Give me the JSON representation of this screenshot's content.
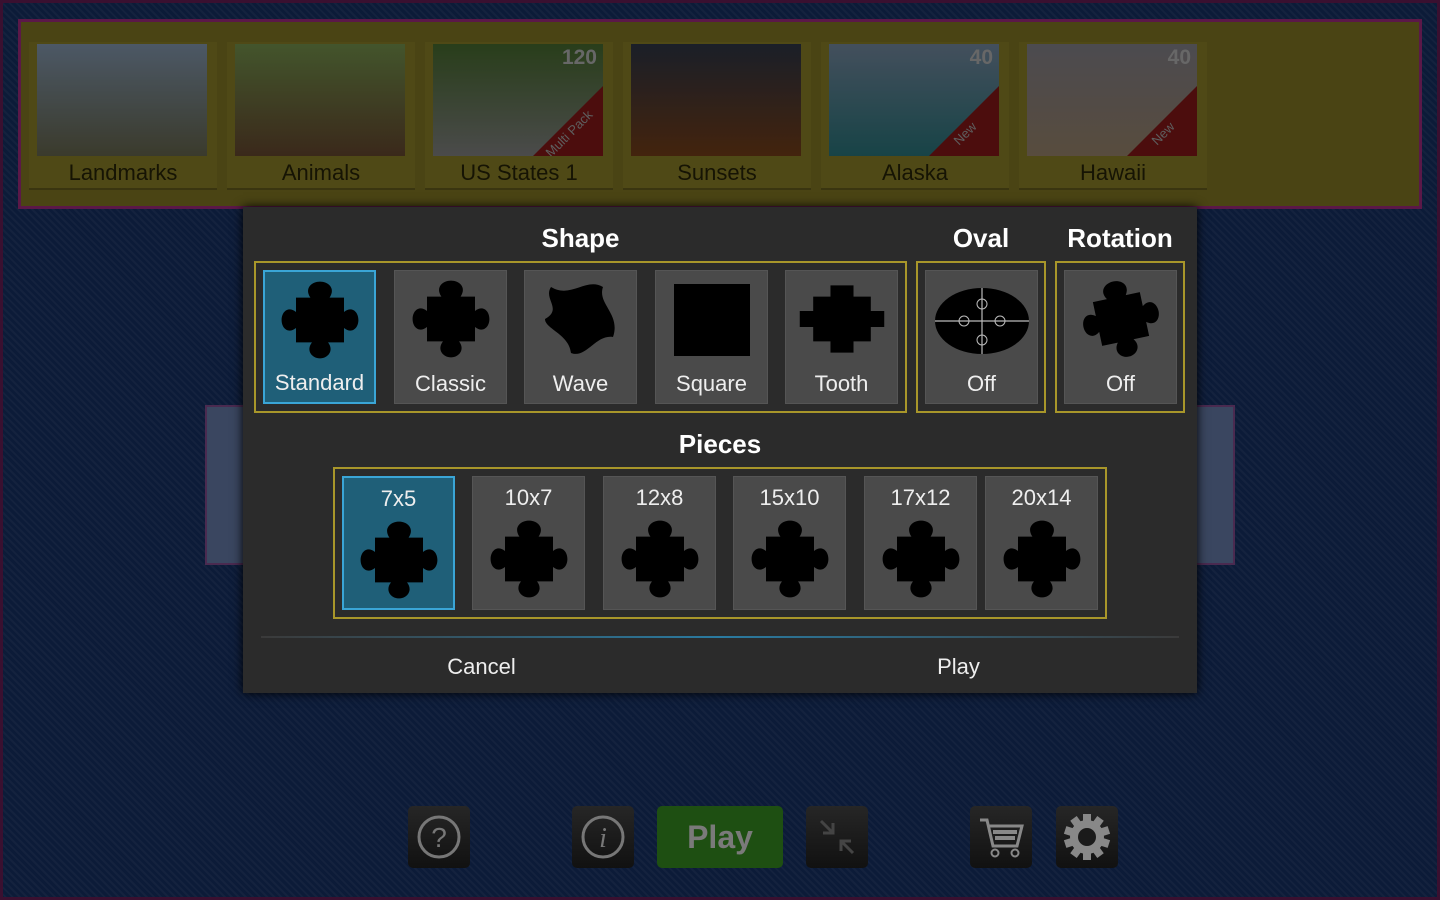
{
  "categories": [
    {
      "label": "Landmarks",
      "colors": [
        "#8aa0b8",
        "#6a6a50"
      ]
    },
    {
      "label": "Animals",
      "colors": [
        "#7a9a50",
        "#6a4a30"
      ]
    },
    {
      "label": "US States 1",
      "count": "120",
      "ribbon": "Multi Pack",
      "colors": [
        "#4a7030",
        "#888"
      ]
    },
    {
      "label": "Sunsets",
      "colors": [
        "#303848",
        "#7a4018"
      ]
    },
    {
      "label": "Alaska",
      "count": "40",
      "ribbon": "New",
      "colors": [
        "#7a90a8",
        "#2a7a80"
      ]
    },
    {
      "label": "Hawaii",
      "count": "40",
      "ribbon": "New",
      "colors": [
        "#8a8890",
        "#a08a70"
      ]
    }
  ],
  "dialog": {
    "shape_heading": "Shape",
    "oval_heading": "Oval",
    "rotation_heading": "Rotation",
    "pieces_heading": "Pieces",
    "shapes": [
      {
        "label": "Standard",
        "selected": true
      },
      {
        "label": "Classic"
      },
      {
        "label": "Wave"
      },
      {
        "label": "Square"
      },
      {
        "label": "Tooth"
      }
    ],
    "oval": {
      "label": "Off"
    },
    "rotation": {
      "label": "Off"
    },
    "pieces": [
      {
        "label": "7x5",
        "selected": true
      },
      {
        "label": "10x7"
      },
      {
        "label": "12x8"
      },
      {
        "label": "15x10"
      },
      {
        "label": "17x12"
      },
      {
        "label": "20x14"
      }
    ],
    "cancel": "Cancel",
    "play": "Play",
    "accent": "#3aa5d6"
  },
  "toolbar": {
    "play": "Play",
    "icons": [
      "help-icon",
      "info-icon",
      "collapse-icon",
      "cart-icon",
      "gear-icon"
    ]
  }
}
